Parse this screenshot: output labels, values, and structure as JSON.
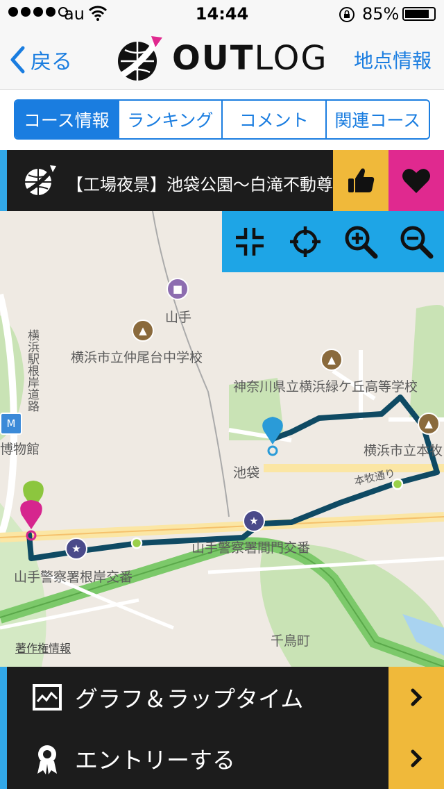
{
  "status_bar": {
    "carrier": "au",
    "time": "14:44",
    "battery_percent": "85%",
    "battery_level": 0.85,
    "signal_bars": 4
  },
  "nav": {
    "back_label": "戻る",
    "logo_text_bold": "OUT",
    "logo_text_light": "LOG",
    "right_label": "地点情報"
  },
  "tabs": [
    {
      "label": "コース情報",
      "active": true
    },
    {
      "label": "ランキング",
      "active": false
    },
    {
      "label": "コメント",
      "active": false
    },
    {
      "label": "関連コース",
      "active": false
    }
  ],
  "course": {
    "title": "【工場夜景】池袋公園〜白滝不動尊"
  },
  "map_tools": [
    "collapse-icon",
    "locate-icon",
    "zoom-in-icon",
    "zoom-out-icon"
  ],
  "map": {
    "labels": {
      "yamate": "山手",
      "nakaodai_school": "横浜市立仲尾台中学校",
      "midorigaoka_school": "神奈川県立横浜緑ケ丘高等学校",
      "yokohama_city": "横浜市立本牧",
      "museum": "博物館",
      "ikebukuro": "池袋",
      "honmoku_road": "本牧通り",
      "police_mamon": "山手警察署間門交番",
      "police_negishi": "山手警察署根岸交番",
      "chidoricho": "千鳥町",
      "negishi_line": "横浜駅根岸道路"
    },
    "copyright": "著作権情報"
  },
  "bottom_menu": [
    {
      "label": "グラフ＆ラップタイム",
      "icon": "graph-icon"
    },
    {
      "label": "エントリーする",
      "icon": "award-icon"
    }
  ],
  "colors": {
    "accent_blue": "#1a7de0",
    "map_tools_blue": "#1ea5e6",
    "like_yellow": "#f0b93a",
    "fav_magenta": "#e0298f",
    "route": "#0f4a63",
    "dark_bar": "#1c1c1c"
  }
}
